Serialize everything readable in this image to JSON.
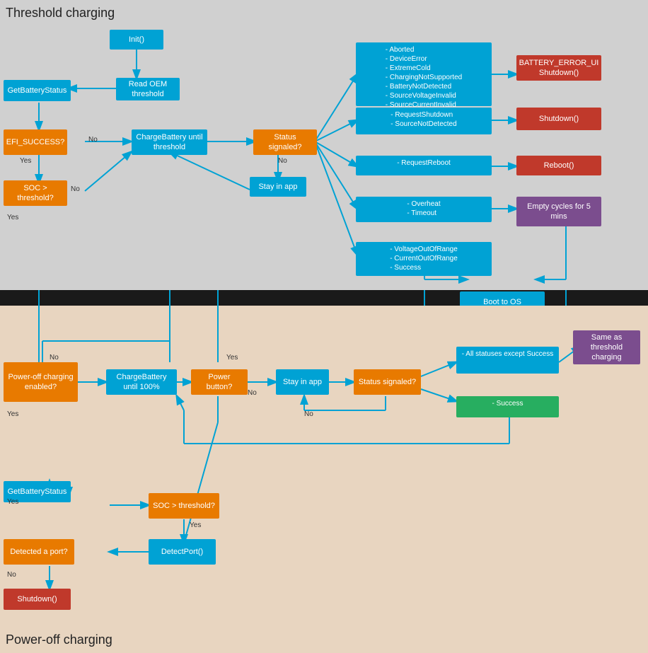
{
  "sections": {
    "top_title": "Threshold charging",
    "bottom_title": "Power-off charging"
  },
  "top_boxes": {
    "init": "Init()",
    "getBatteryStatus": "GetBatteryStatus",
    "readOEM": "Read OEM threshold",
    "efiSuccess": "EFI_SUCCESS?",
    "chargeBatteryUntilThreshold": "ChargeBattery until threshold",
    "socThreshold": "SOC > threshold?",
    "statusSignaled": "Status signaled?",
    "stayInApp": "Stay in app",
    "errors1": "- Aborted\n- DeviceError\n- ExtremeCold\n- ChargingNotSupported\n- BatteryNotDetected\n- SourceVoltageInvalid\n- SourceCurrentInvalid",
    "errors2": "- RequestShutdown\n- SourceNotDetected",
    "errors3": "- RequestReboot",
    "errors4": "- Overheat\n- Timeout",
    "errors5": "- VoltageOutOfRange\n- CurrentOutOfRange\n- Success",
    "batteryErrorUI": "BATTERY_ERROR_UI Shutdown()",
    "shutdown1": "Shutdown()",
    "reboot": "Reboot()",
    "emptyCycles": "Empty cycles for 5 mins",
    "bootToOS": "Boot to OS"
  },
  "bottom_boxes": {
    "powerOffEnabled": "Power-off charging enabled?",
    "chargeBattery100": "ChargeBattery until 100%",
    "powerButton": "Power button?",
    "stayInApp": "Stay in app",
    "statusSignaled": "Status signaled?",
    "allStatusExceptSuccess": "- All statuses except Success",
    "success": "- Success",
    "sameAsThreshold": "Same as threshold charging",
    "getBatteryStatus": "GetBatteryStatus",
    "socThreshold": "SOC > threshold?",
    "detectedPort": "Detected a port?",
    "detectPort": "DetectPort()",
    "shutdown": "Shutdown()"
  },
  "labels": {
    "no": "No",
    "yes": "Yes",
    "boot_to": "Boot to"
  }
}
